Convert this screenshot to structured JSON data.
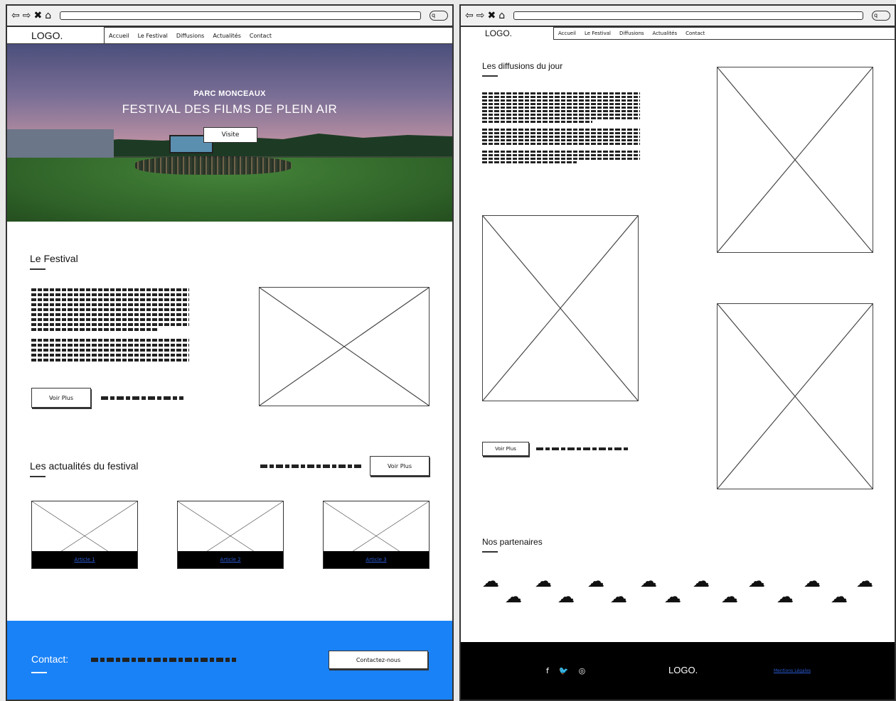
{
  "browser": {
    "back_icon": "⇦",
    "forward_icon": "⇨",
    "close_icon": "✖",
    "home_icon": "⌂",
    "search_icon": "q"
  },
  "nav": {
    "logo": "LOGO.",
    "items": [
      "Accueil",
      "Le Festival",
      "Diffusions",
      "Actualités",
      "Contact"
    ]
  },
  "hero": {
    "subtitle": "PARC MONCEAUX",
    "title": "FESTIVAL DES FILMS DE PLEIN AIR",
    "button": "Visite"
  },
  "festival": {
    "heading": "Le Festival",
    "button": "Voir Plus"
  },
  "news": {
    "heading": "Les actualités du festival",
    "button": "Voir Plus",
    "articles": [
      "Article 1",
      "Article 2",
      "Article 3"
    ]
  },
  "contact": {
    "label": "Contact:",
    "button": "Contactez-nous"
  },
  "diffusions": {
    "heading": "Les diffusions du jour",
    "button": "Voir Plus"
  },
  "partners": {
    "heading": "Nos partenaires",
    "cloud_icon": "☁"
  },
  "footer": {
    "social": [
      "f",
      "🐦",
      "◎"
    ],
    "logo": "LOGO.",
    "legal": "Mentions Légales"
  }
}
